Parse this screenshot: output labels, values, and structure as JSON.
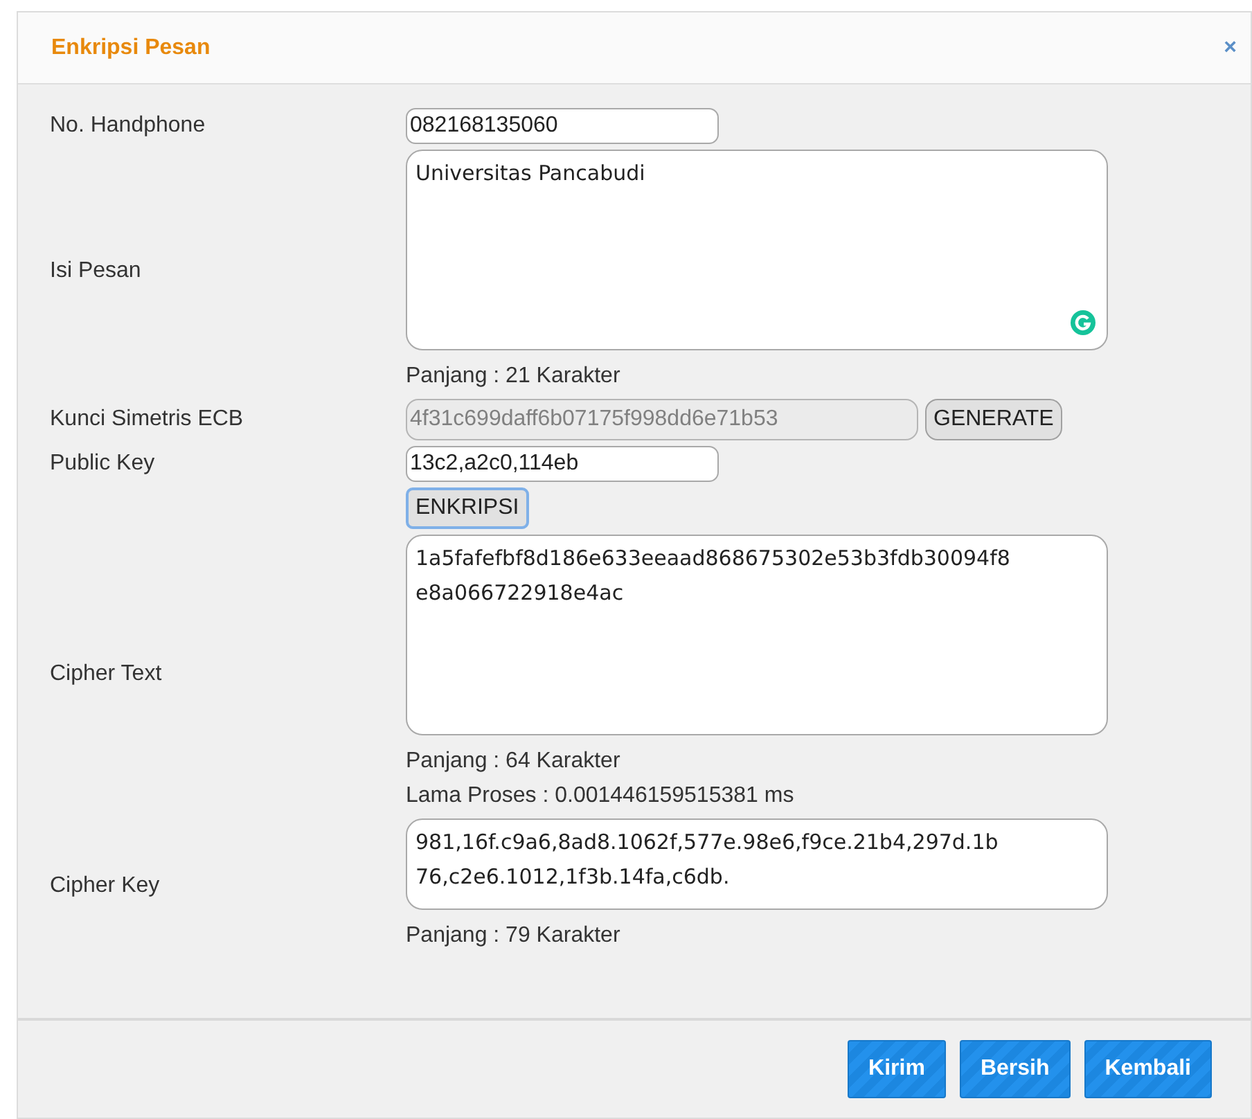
{
  "dialog": {
    "title": "Enkripsi Pesan",
    "close": "×"
  },
  "rows": [
    {
      "kind": "input",
      "label": "No. Handphone",
      "value": "082168135060",
      "disabled": false
    },
    {
      "kind": "textarea",
      "label": "Isi Pesan",
      "value": "Universitas Pancabudi",
      "notes": [
        "Panjang : 21 Karakter"
      ],
      "grammar_badge": true
    },
    {
      "kind": "input_button",
      "label": "Kunci Simetris ECB",
      "value": "4f31c699daff6b07175f998dd6e71b53",
      "disabled": true,
      "button": "GENERATE"
    },
    {
      "kind": "input",
      "label": "Public Key",
      "value": "13c2,a2c0,114eb",
      "disabled": false
    },
    {
      "kind": "button",
      "button": "ENKRIPSI",
      "focused": true
    },
    {
      "kind": "textarea",
      "label": "Cipher Text",
      "value": "1a5fafefbf8d186e633eeaad868675302e53b3fdb30094f8e8a066722918e4ac",
      "notes": [
        "Panjang : 64 Karakter",
        "Lama Proses : 0.001446159515381 ms"
      ]
    },
    {
      "kind": "short_textarea",
      "label": "Cipher Key",
      "value": "981,16f.c9a6,8ad8.1062f,577e.98e6,f9ce.21b4,297d.1b76,c2e6.1012,1f3b.14fa,c6db.",
      "notes": [
        "Panjang : 79 Karakter"
      ]
    }
  ],
  "footer_buttons": [
    "Kirim",
    "Bersih",
    "Kembali"
  ]
}
